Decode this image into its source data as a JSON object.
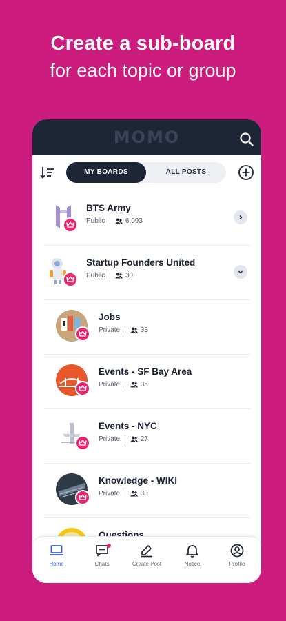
{
  "promo": {
    "headline": "Create a sub-board",
    "subheadline": "for each topic or group"
  },
  "app": {
    "logo": "MOMO",
    "search_icon": "search-icon",
    "sort_icon": "sort-icon",
    "add_icon": "add-circle-icon",
    "colors": {
      "brand_bg": "#cc1d7e",
      "appbar": "#1e2537",
      "crown": "#e9236e",
      "active_nav": "#3b5bdb"
    }
  },
  "tabs": [
    {
      "label": "MY BOARDS",
      "active": true
    },
    {
      "label": "ALL POSTS",
      "active": false
    }
  ],
  "boards": [
    {
      "name": "BTS Army",
      "visibility": "Public",
      "members": "6,093",
      "chevron": "chevron-right-icon"
    },
    {
      "name": "Startup Founders United",
      "visibility": "Public",
      "members": "30",
      "chevron": "chevron-down-icon"
    },
    {
      "name": "Jobs",
      "visibility": "Private",
      "members": "33"
    },
    {
      "name": "Events - SF Bay Area",
      "visibility": "Private",
      "members": "35"
    },
    {
      "name": "Events - NYC",
      "visibility": "Private",
      "members": "27"
    },
    {
      "name": "Knowledge - WIKI",
      "visibility": "Private",
      "members": "33"
    },
    {
      "name": "Questions",
      "visibility": "",
      "members": ""
    }
  ],
  "meta_separator": "|",
  "nav": [
    {
      "label": "Home",
      "icon": "laptop-icon",
      "active": true
    },
    {
      "label": "Chats",
      "icon": "chat-icon",
      "active": false,
      "badge": true
    },
    {
      "label": "Create Post",
      "icon": "pencil-icon",
      "active": false
    },
    {
      "label": "Notice",
      "icon": "bell-icon",
      "active": false
    },
    {
      "label": "Profile",
      "icon": "profile-icon",
      "active": false
    }
  ]
}
